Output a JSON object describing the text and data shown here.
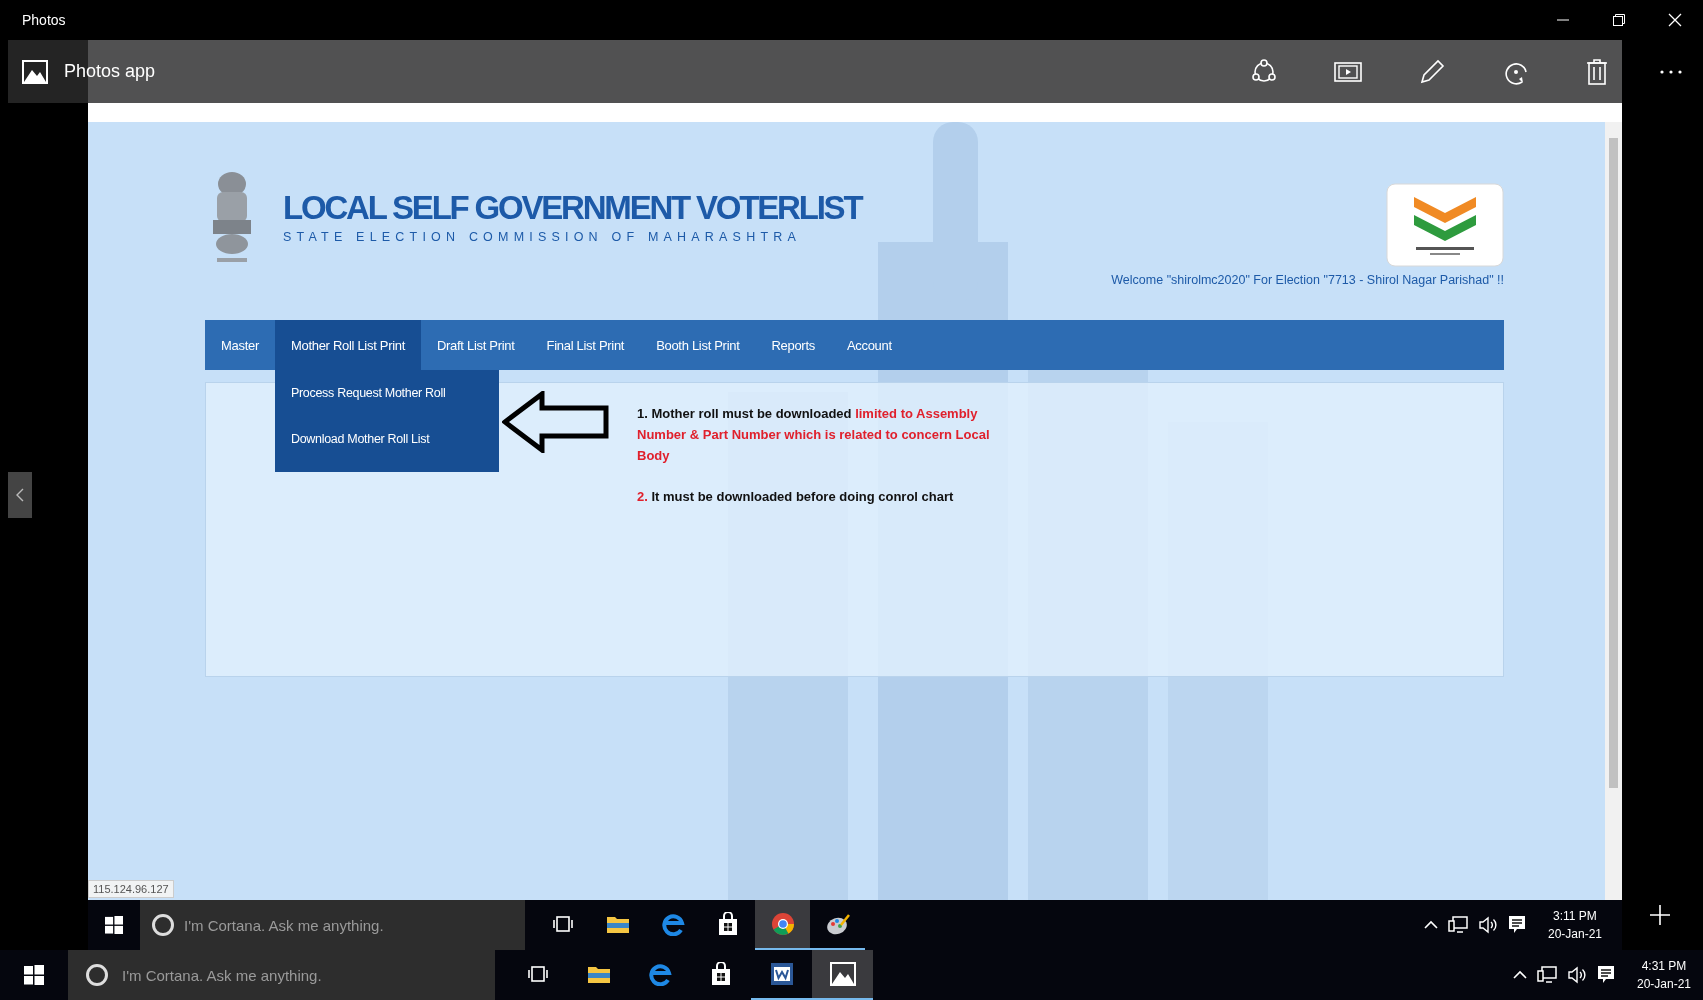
{
  "window": {
    "title": "Photos"
  },
  "photos_toolbar": {
    "title": "Photos app"
  },
  "browser": {
    "status_url": "115.124.96.127"
  },
  "page": {
    "title": "LOCAL SELF GOVERNMENT VOTERLIST",
    "subtitle": "STATE ELECTION COMMISSION OF MAHARASHTRA",
    "welcome": "Welcome \"shirolmc2020\" For Election \"7713 - Shirol Nagar Parishad\" !!",
    "nav": [
      {
        "label": "Master",
        "selected": false
      },
      {
        "label": "Mother Roll List Print",
        "selected": true
      },
      {
        "label": "Draft List Print",
        "selected": false
      },
      {
        "label": "Final List Print",
        "selected": false
      },
      {
        "label": "Booth List Print",
        "selected": false
      },
      {
        "label": "Reports",
        "selected": false
      },
      {
        "label": "Account",
        "selected": false
      }
    ],
    "dropdown": [
      "Process Request Mother Roll",
      "Download Mother Roll List"
    ],
    "notes": [
      [
        {
          "text": "1. Mother roll must be downloaded ",
          "emphasis": false
        },
        {
          "text": "limited to Assembly Number & Part Number which is related to concern Local Body",
          "emphasis": true
        }
      ],
      [
        {
          "text": "2.",
          "emphasis": true
        },
        {
          "text": " It must be downloaded before doing conrol chart",
          "emphasis": false
        }
      ]
    ]
  },
  "inner_taskbar": {
    "search_placeholder": "I'm Cortana. Ask me anything.",
    "time": "3:11 PM",
    "date": "20-Jan-21",
    "apps": [
      {
        "kind": "task-view",
        "running": false,
        "selected": false
      },
      {
        "kind": "file-explorer",
        "running": false,
        "selected": false
      },
      {
        "kind": "edge",
        "running": false,
        "selected": false
      },
      {
        "kind": "store",
        "running": false,
        "selected": false
      },
      {
        "kind": "chrome",
        "running": true,
        "selected": true
      },
      {
        "kind": "paint",
        "running": true,
        "selected": false
      }
    ]
  },
  "taskbar": {
    "search_placeholder": "I'm Cortana. Ask me anything.",
    "time": "4:31 PM",
    "date": "20-Jan-21",
    "apps": [
      {
        "kind": "task-view",
        "running": false,
        "selected": false
      },
      {
        "kind": "file-explorer",
        "running": false,
        "selected": false
      },
      {
        "kind": "edge",
        "running": false,
        "selected": false
      },
      {
        "kind": "store",
        "running": false,
        "selected": false
      },
      {
        "kind": "word",
        "running": true,
        "selected": false
      },
      {
        "kind": "photos",
        "running": true,
        "selected": true
      }
    ]
  }
}
